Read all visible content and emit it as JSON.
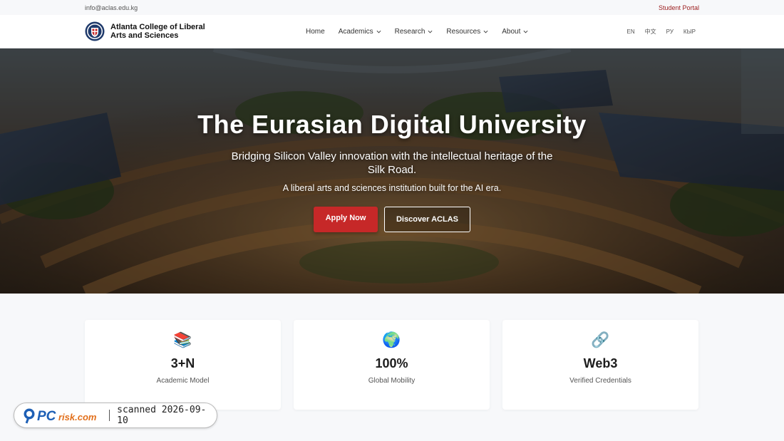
{
  "topbar": {
    "email": "info@aclas.edu.kg",
    "portal": "Student Portal"
  },
  "brand": {
    "name_line1": "Atlanta College of Liberal",
    "name_line2": "Arts and Sciences",
    "logo_icon": "university-crest-icon"
  },
  "nav": {
    "items": [
      {
        "label": "Home",
        "dropdown": false
      },
      {
        "label": "Academics",
        "dropdown": true
      },
      {
        "label": "Research",
        "dropdown": true
      },
      {
        "label": "Resources",
        "dropdown": true
      },
      {
        "label": "About",
        "dropdown": true
      }
    ],
    "languages": [
      "EN",
      "中文",
      "РУ",
      "КЫР"
    ]
  },
  "hero": {
    "title": "The Eurasian Digital University",
    "subtitle": "Bridging Silicon Valley innovation with the intellectual heritage of the Silk Road.",
    "tagline": "A liberal arts and sciences institution built for the AI era.",
    "primary_button": "Apply Now",
    "secondary_button": "Discover ACLAS"
  },
  "stats": [
    {
      "icon": "📚",
      "icon_name": "books-icon",
      "value": "3+N",
      "label": "Academic Model"
    },
    {
      "icon": "🌍",
      "icon_name": "globe-icon",
      "value": "100%",
      "label": "Global Mobility"
    },
    {
      "icon": "🔗",
      "icon_name": "link-icon",
      "value": "Web3",
      "label": "Verified Credentials"
    }
  ],
  "badge": {
    "logo_text": "PCrisk.com",
    "text": "scanned 2026-09-10"
  },
  "colors": {
    "accent": "#c62828",
    "portal_link": "#9b1c1c",
    "background": "#f7f8fa"
  }
}
